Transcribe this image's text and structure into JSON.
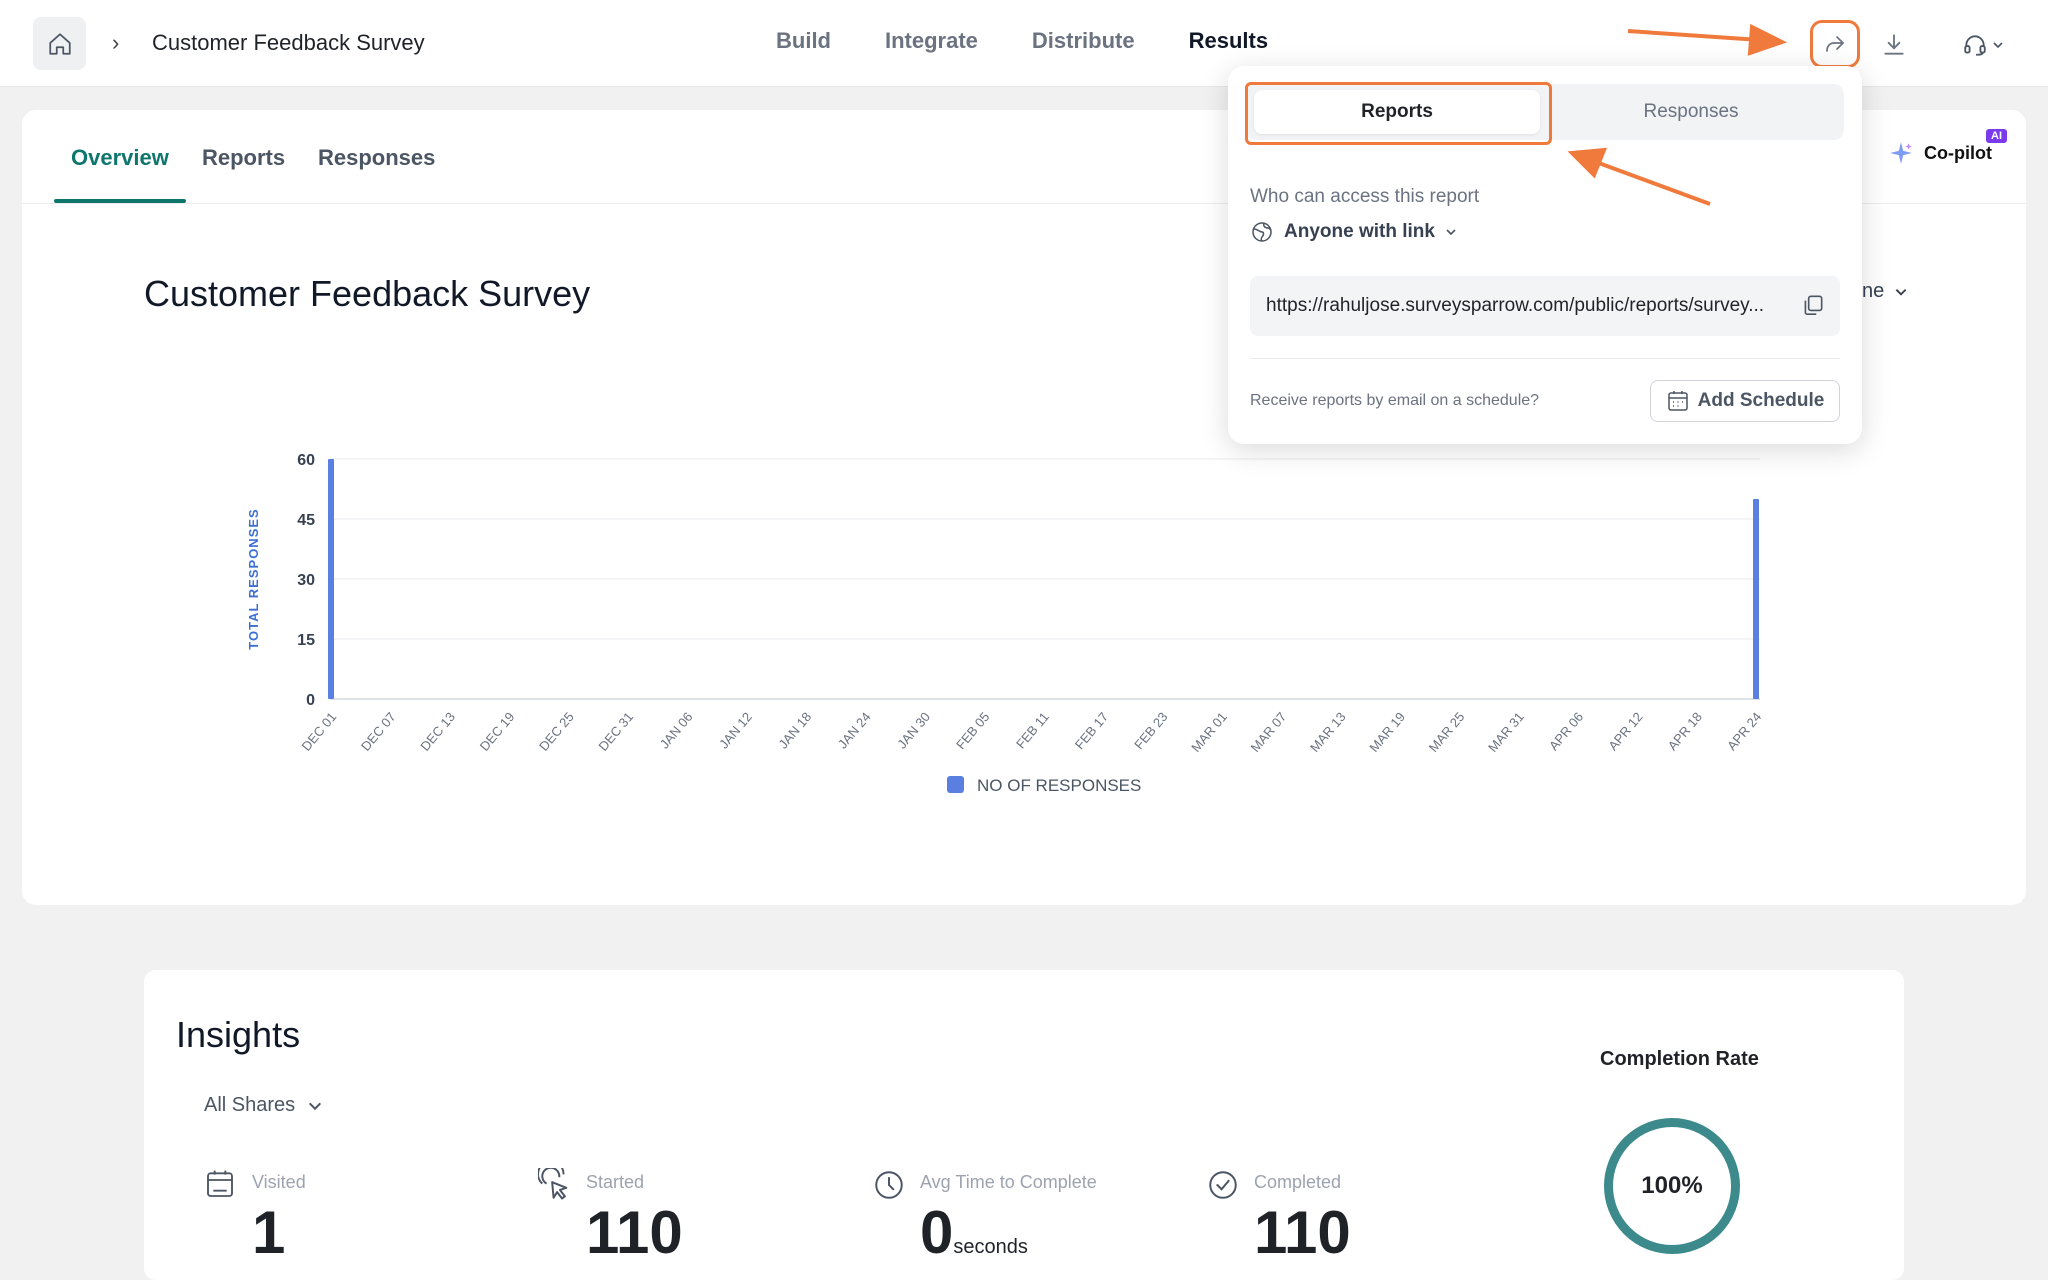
{
  "header": {
    "breadcrumb_separator": "›",
    "survey_name": "Customer Feedback Survey",
    "nav": [
      "Build",
      "Integrate",
      "Distribute",
      "Results"
    ],
    "active_nav": "Results"
  },
  "subtabs": {
    "items": [
      "Overview",
      "Reports",
      "Responses"
    ],
    "active": "Overview"
  },
  "copilot": {
    "label": "Co-pilot",
    "badge": "AI"
  },
  "page_title": "Customer Feedback Survey",
  "range_peek": "ne",
  "chart_data": {
    "type": "bar",
    "categories": [
      "DEC 01",
      "DEC 07",
      "DEC 13",
      "DEC 19",
      "DEC 25",
      "DEC 31",
      "JAN 06",
      "JAN 12",
      "JAN 18",
      "JAN 24",
      "JAN 30",
      "FEB 05",
      "FEB 11",
      "FEB 17",
      "FEB 23",
      "MAR 01",
      "MAR 07",
      "MAR 13",
      "MAR 19",
      "MAR 25",
      "MAR 31",
      "APR 06",
      "APR 12",
      "APR 18",
      "APR 24"
    ],
    "series": [
      {
        "name": "NO OF RESPONSES",
        "values": [
          60,
          0,
          0,
          0,
          0,
          0,
          0,
          0,
          0,
          0,
          0,
          0,
          0,
          0,
          0,
          0,
          0,
          0,
          0,
          0,
          0,
          0,
          0,
          0,
          50
        ]
      }
    ],
    "yticks": [
      0,
      15,
      30,
      45,
      60
    ],
    "ylim": [
      0,
      60
    ],
    "ylabel": "TOTAL RESPONSES",
    "xlabel": "",
    "legend_position": "bottom",
    "grid": true,
    "bar_color": "#5b7fe0"
  },
  "insights": {
    "title": "Insights",
    "filter": "All Shares",
    "metrics": [
      {
        "label": "Visited",
        "value": "1",
        "unit": ""
      },
      {
        "label": "Started",
        "value": "110",
        "unit": ""
      },
      {
        "label": "Avg Time to Complete",
        "value": "0",
        "unit": "seconds"
      },
      {
        "label": "Completed",
        "value": "110",
        "unit": ""
      }
    ],
    "completion_title": "Completion Rate",
    "completion_value": "100%"
  },
  "share_popover": {
    "tabs": [
      "Reports",
      "Responses"
    ],
    "active_tab": "Reports",
    "access_label": "Who can access this report",
    "access_value": "Anyone with link",
    "link": "https://rahuljose.surveysparrow.com/public/reports/survey...",
    "schedule_prompt": "Receive reports by email on a schedule?",
    "schedule_button": "Add Schedule"
  },
  "colors": {
    "accent_teal": "#0f766e",
    "annotation_orange": "#f07a3c",
    "ring": "#3d8a8c"
  }
}
